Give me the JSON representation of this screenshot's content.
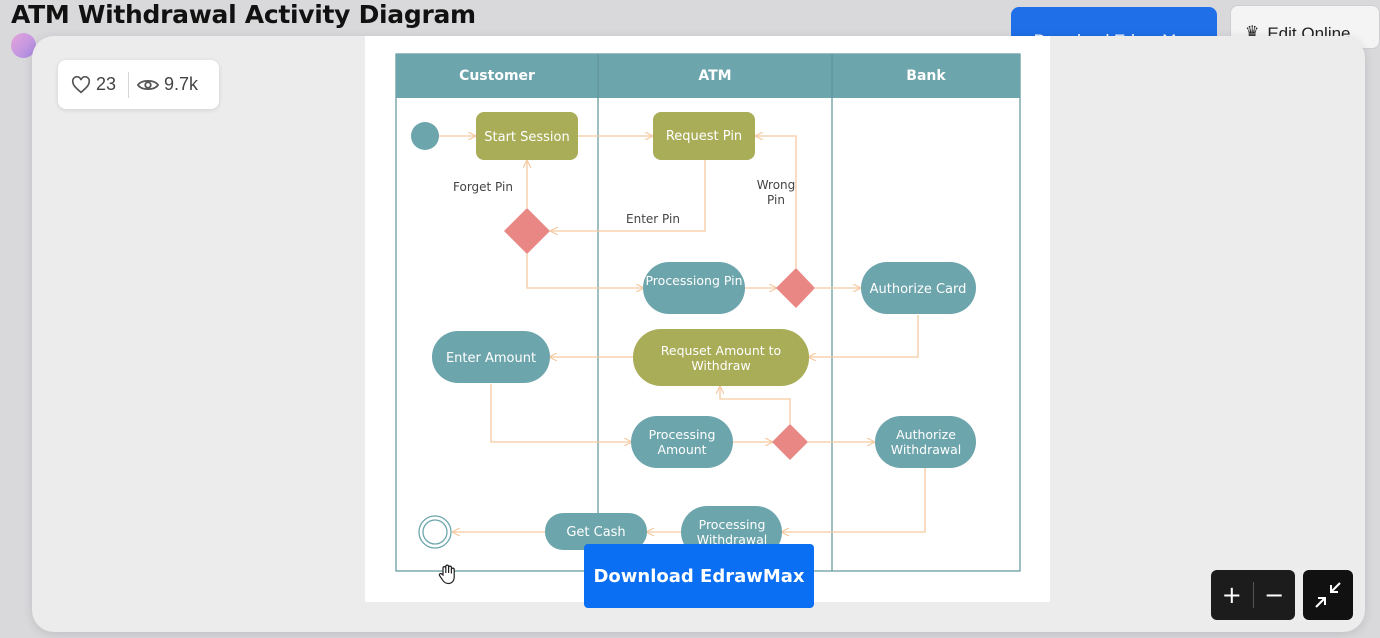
{
  "page": {
    "title": "ATM Withdrawal Activity Diagram",
    "download_label": "Download EdrawMax",
    "edit_label": "Edit Online"
  },
  "stats": {
    "likes": "23",
    "views": "9.7k"
  },
  "diagram": {
    "lanes": [
      "Customer",
      "ATM",
      "Bank"
    ],
    "nodes": {
      "start_session": "Start Session",
      "request_pin": "Request Pin",
      "processing_pin": "Processiong Pin",
      "authorize_card": "Authorize Card",
      "enter_amount": "Enter Amount",
      "request_amount_1": "Requset Amount to",
      "request_amount_2": "Withdraw",
      "processing_amount_1": "Processing",
      "processing_amount_2": "Amount",
      "authorize_withdrawal_1": "Authorize",
      "authorize_withdrawal_2": "Withdrawal",
      "processing_withdrawal_1": "Processing",
      "processing_withdrawal_2": "Withdrawal",
      "get_cash": "Get Cash"
    },
    "labels": {
      "forget_pin": "Forget Pin",
      "enter_pin": "Enter Pin",
      "wrong_pin_1": "Wrong",
      "wrong_pin_2": "Pin"
    },
    "colors": {
      "lane_header": "#6ca5ab",
      "teal_node": "#6da5ac",
      "olive_node": "#a9ad58",
      "decision": "#e88784",
      "arrow": "#f5c9a0"
    }
  },
  "cta": {
    "download_label": "Download EdrawMax"
  },
  "zoom": {
    "in": "+",
    "out": "−"
  }
}
